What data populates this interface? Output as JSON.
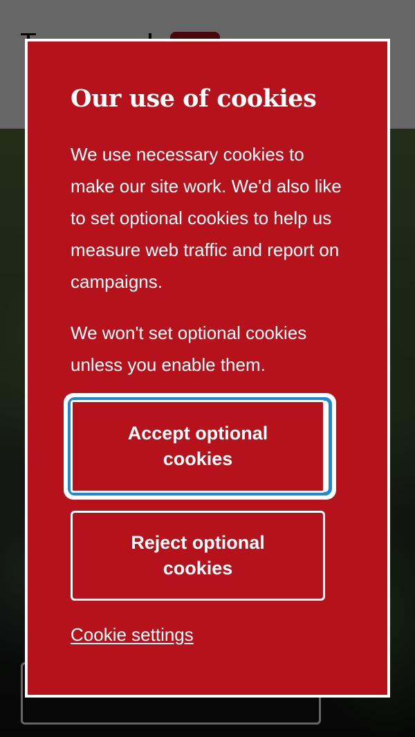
{
  "cookie_modal": {
    "title": "Our use of cookies",
    "paragraph_1": "We use necessary cookies to make our site work. We'd also like to set optional cookies to help us measure web traffic and report on campaigns.",
    "paragraph_2": "We won't set optional cookies unless you enable them.",
    "accept_label": "Accept optional cookies",
    "reject_label": "Reject optional cookies",
    "settings_link": "Cookie settings"
  },
  "colors": {
    "modal_background": "#b5121b",
    "text": "#ffffff",
    "focus_ring": "#1d88d6"
  }
}
